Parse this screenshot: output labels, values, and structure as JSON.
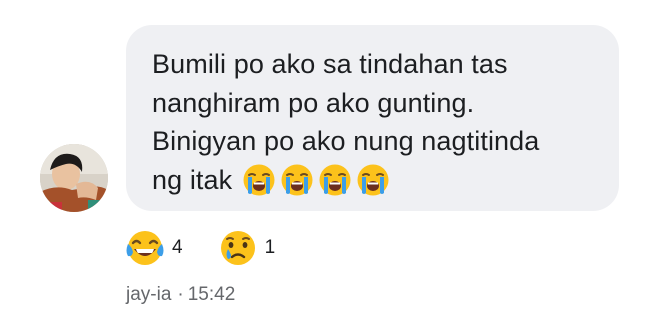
{
  "comment": {
    "lines": [
      "Bumili po ako sa tindahan tas",
      "nanghiram po ako gunting.",
      "Binigyan po ako nung nagtitinda",
      "ng itak"
    ],
    "emojis": [
      "crying-face",
      "crying-face",
      "crying-face",
      "crying-face"
    ]
  },
  "reactions": [
    {
      "icon": "tears-of-joy-icon",
      "count": "4"
    },
    {
      "icon": "sad-tear-icon",
      "count": "1"
    }
  ],
  "meta": {
    "author": "jay-ia",
    "separator": "·",
    "time": "15:42"
  },
  "colors": {
    "bubble": "#eff0f3",
    "text": "#1c1e21",
    "meta": "#65676b",
    "emoji_yellow": "#fcc21b",
    "tear_blue": "#3c9ee8"
  }
}
